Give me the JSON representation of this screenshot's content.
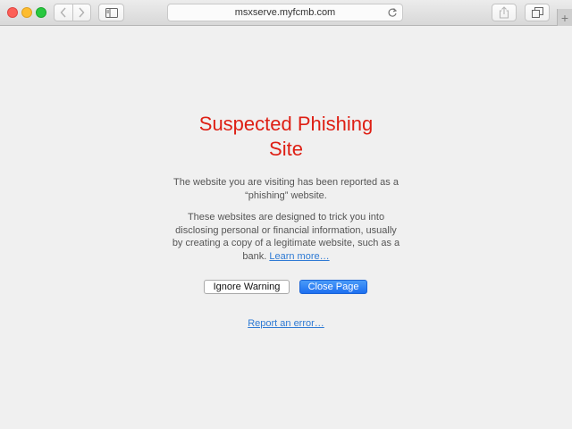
{
  "window": {
    "traffic_lights": [
      "close",
      "minimize",
      "zoom"
    ],
    "url": "msxserve.myfcmb.com",
    "new_tab_label": "+"
  },
  "toolbar": {
    "back_icon": "chevron-left-icon",
    "forward_icon": "chevron-right-icon",
    "sidebar_icon": "sidebar-icon",
    "share_icon": "share-icon",
    "tabs_icon": "tabs-overview-icon",
    "reload_icon": "reload-icon"
  },
  "warning": {
    "title_line1": "Suspected Phishing",
    "title_line2": "Site",
    "paragraph1": "The website you are visiting has been reported as a “phishing” website.",
    "paragraph2": "These websites are designed to trick you into disclosing personal or financial information, usually by creating a copy of a legitimate website, such as a bank.",
    "learn_more": "Learn more…",
    "ignore_button": "Ignore Warning",
    "close_button": "Close Page",
    "report_link": "Report an error…"
  },
  "colors": {
    "title": "#de1f14",
    "link": "#2e7ad4",
    "primary_button": "#1d6ff0",
    "background": "#f0f0f0"
  }
}
